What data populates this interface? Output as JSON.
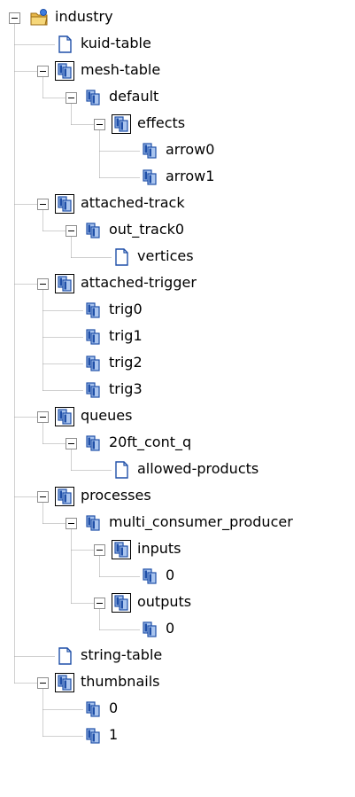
{
  "tree": {
    "nodes": [
      {
        "label": "industry",
        "depth": 0,
        "icon": "folder-icon",
        "expanded": true
      },
      {
        "label": "kuid-table",
        "depth": 1,
        "icon": "document-icon"
      },
      {
        "label": "mesh-table",
        "depth": 1,
        "icon": "container-icon",
        "expanded": true
      },
      {
        "label": "default",
        "depth": 2,
        "icon": "object-icon",
        "expanded": true
      },
      {
        "label": "effects",
        "depth": 3,
        "icon": "container-icon",
        "expanded": true
      },
      {
        "label": "arrow0",
        "depth": 4,
        "icon": "object-icon"
      },
      {
        "label": "arrow1",
        "depth": 4,
        "icon": "object-icon"
      },
      {
        "label": "attached-track",
        "depth": 1,
        "icon": "container-icon",
        "expanded": true
      },
      {
        "label": "out_track0",
        "depth": 2,
        "icon": "object-icon",
        "expanded": true
      },
      {
        "label": "vertices",
        "depth": 3,
        "icon": "document-icon"
      },
      {
        "label": "attached-trigger",
        "depth": 1,
        "icon": "container-icon",
        "expanded": true
      },
      {
        "label": "trig0",
        "depth": 2,
        "icon": "object-icon"
      },
      {
        "label": "trig1",
        "depth": 2,
        "icon": "object-icon"
      },
      {
        "label": "trig2",
        "depth": 2,
        "icon": "object-icon"
      },
      {
        "label": "trig3",
        "depth": 2,
        "icon": "object-icon"
      },
      {
        "label": "queues",
        "depth": 1,
        "icon": "container-icon",
        "expanded": true
      },
      {
        "label": "20ft_cont_q",
        "depth": 2,
        "icon": "object-icon",
        "expanded": true
      },
      {
        "label": "allowed-products",
        "depth": 3,
        "icon": "document-icon"
      },
      {
        "label": "processes",
        "depth": 1,
        "icon": "container-icon",
        "expanded": true
      },
      {
        "label": "multi_consumer_producer",
        "depth": 2,
        "icon": "object-icon",
        "expanded": true
      },
      {
        "label": "inputs",
        "depth": 3,
        "icon": "container-icon",
        "expanded": true
      },
      {
        "label": "0",
        "depth": 4,
        "icon": "object-icon"
      },
      {
        "label": "outputs",
        "depth": 3,
        "icon": "container-icon",
        "expanded": true
      },
      {
        "label": "0",
        "depth": 4,
        "icon": "object-icon"
      },
      {
        "label": "string-table",
        "depth": 1,
        "icon": "document-icon"
      },
      {
        "label": "thumbnails",
        "depth": 1,
        "icon": "container-icon",
        "expanded": true
      },
      {
        "label": "0",
        "depth": 2,
        "icon": "object-icon"
      },
      {
        "label": "1",
        "depth": 2,
        "icon": "object-icon"
      }
    ]
  },
  "colors": {
    "tree_line": "#a0a0a0",
    "expander_border": "#8e8e8e",
    "object_dark": "#1f4fa8",
    "object_light": "#a9c4ee",
    "folder": "#e8b84a"
  }
}
